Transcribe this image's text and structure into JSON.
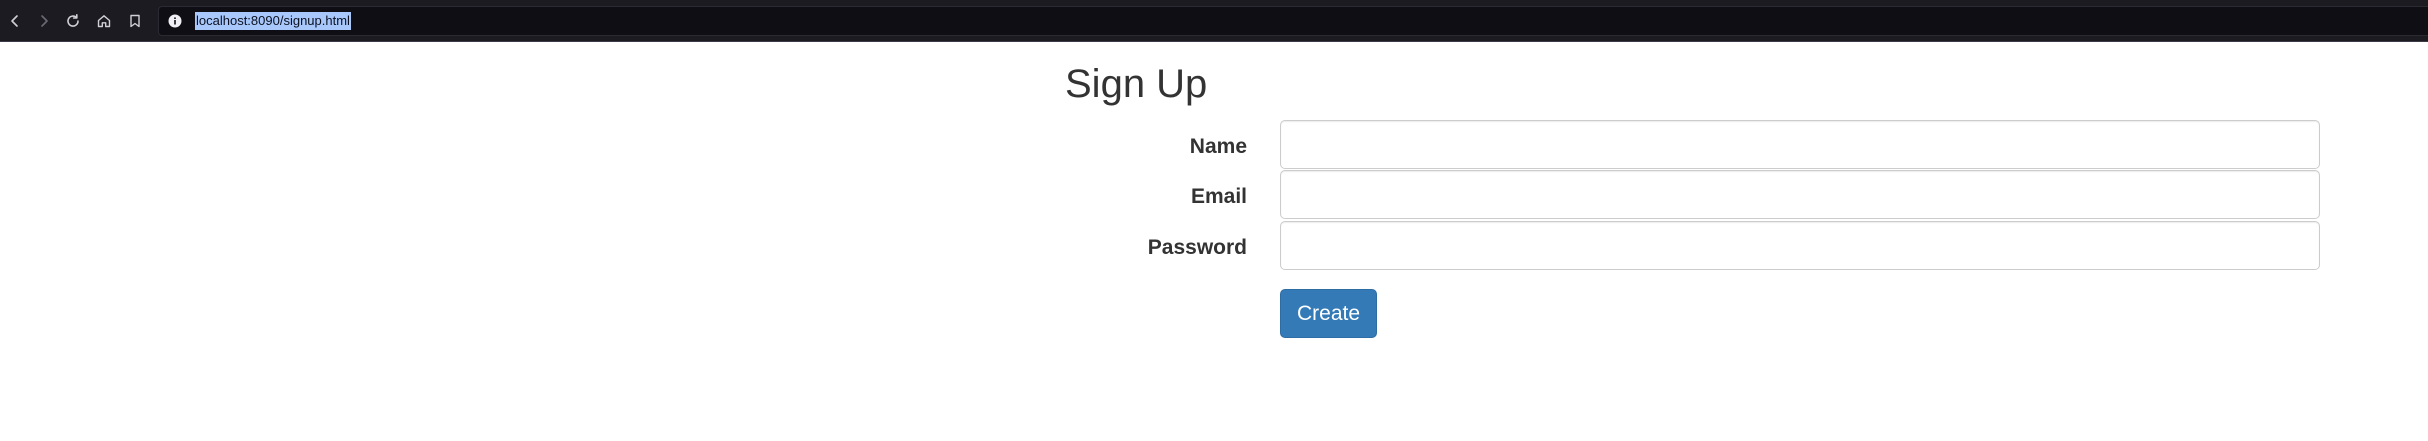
{
  "browser": {
    "url": "localhost:8090/signup.html",
    "icons": [
      "back-icon",
      "forward-icon",
      "reload-icon",
      "home-icon",
      "bookmark-icon",
      "site-info-icon"
    ]
  },
  "form": {
    "title": "Sign Up",
    "fields": [
      {
        "label": "Name",
        "value": "",
        "type": "text"
      },
      {
        "label": "Email",
        "value": "",
        "type": "email"
      },
      {
        "label": "Password",
        "value": "",
        "type": "password"
      }
    ],
    "submit_label": "Create"
  },
  "colors": {
    "browser_bar": "#1c1b22",
    "url_highlight": "#a8c7fa",
    "primary_button": "#337ab7",
    "text": "#333333",
    "input_border": "#cccccc"
  }
}
